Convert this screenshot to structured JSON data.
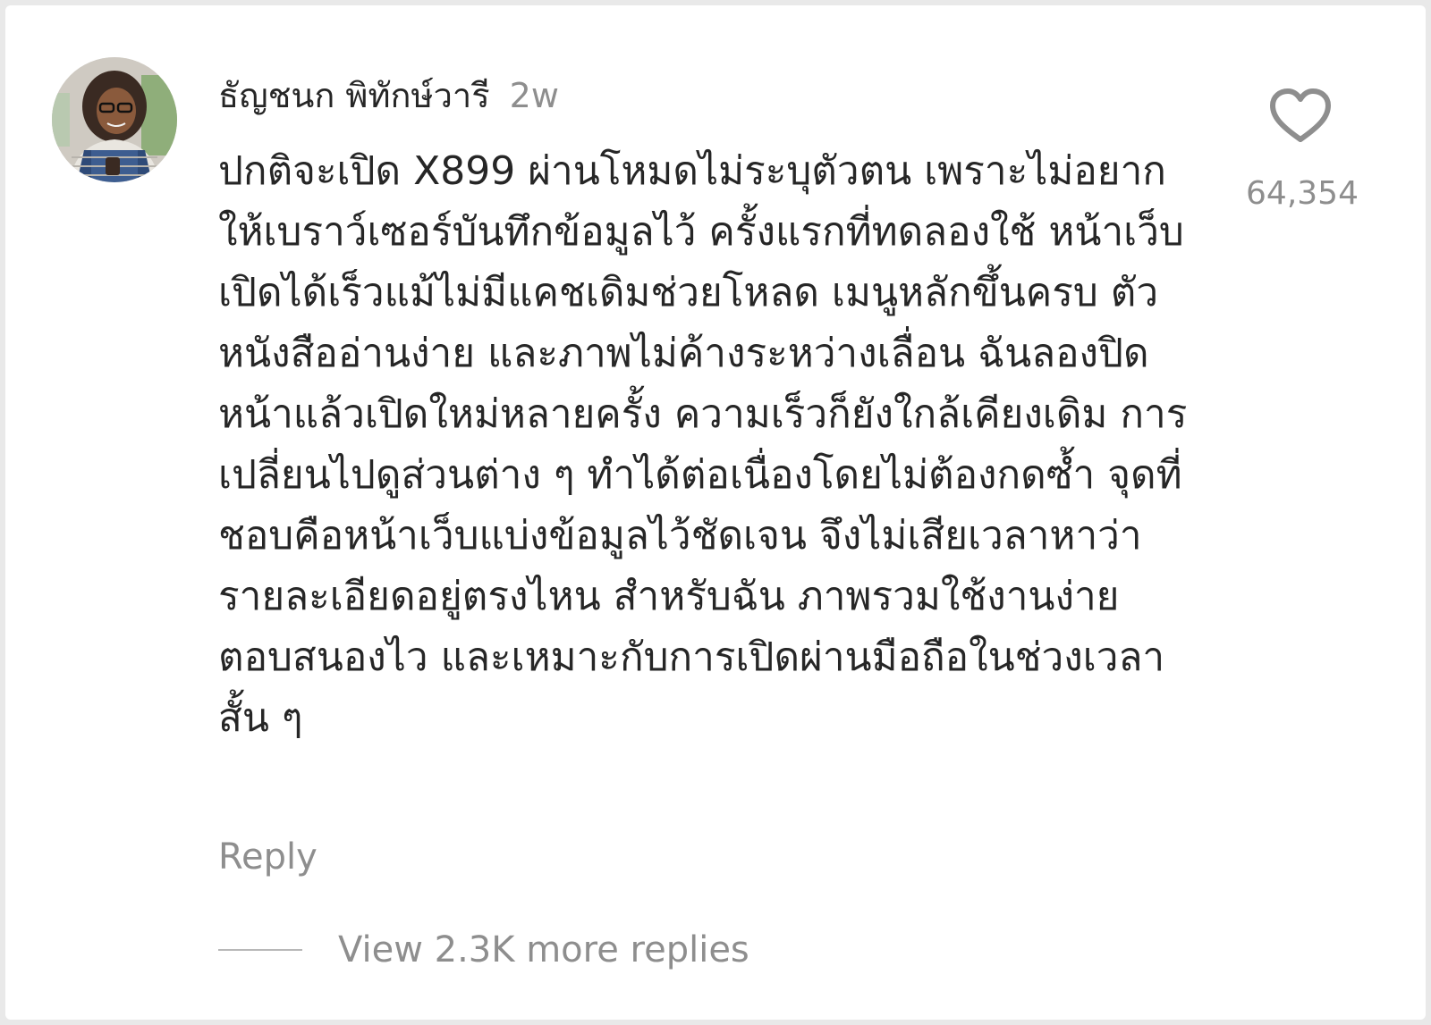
{
  "comment": {
    "username": "ธัญชนก พิทักษ์วารี",
    "timestamp": "2w",
    "text": "ปกติจะเปิด X899 ผ่านโหมดไม่ระบุตัวตน เพราะไม่อยากให้เบราว์เซอร์บันทึกข้อมูลไว้ ครั้งแรกที่ทดลองใช้ หน้าเว็บเปิดได้เร็วแม้ไม่มีแคชเดิมช่วยโหลด เมนูหลักขึ้นครบ ตัวหนังสืออ่านง่าย และภาพไม่ค้างระหว่างเลื่อน ฉันลองปิดหน้าแล้วเปิดใหม่หลายครั้ง ความเร็วก็ยังใกล้เคียงเดิม การเปลี่ยนไปดูส่วนต่าง ๆ ทำได้ต่อเนื่องโดยไม่ต้องกดซ้ำ จุดที่ชอบคือหน้าเว็บแบ่งข้อมูลไว้ชัดเจน จึงไม่เสียเวลาหาว่ารายละเอียดอยู่ตรงไหน สำหรับฉัน ภาพรวมใช้งานง่าย ตอบสนองไว และเหมาะกับการเปิดผ่านมือถือในช่วงเวลาสั้น ๆ",
    "like_icon": "heart-outline-icon",
    "like_count": "64,354",
    "reply_label": "Reply",
    "view_replies_label": "View 2.3K more replies"
  },
  "colors": {
    "primary_text": "#262626",
    "secondary_text": "#8e8e8e",
    "background": "#ffffff"
  }
}
